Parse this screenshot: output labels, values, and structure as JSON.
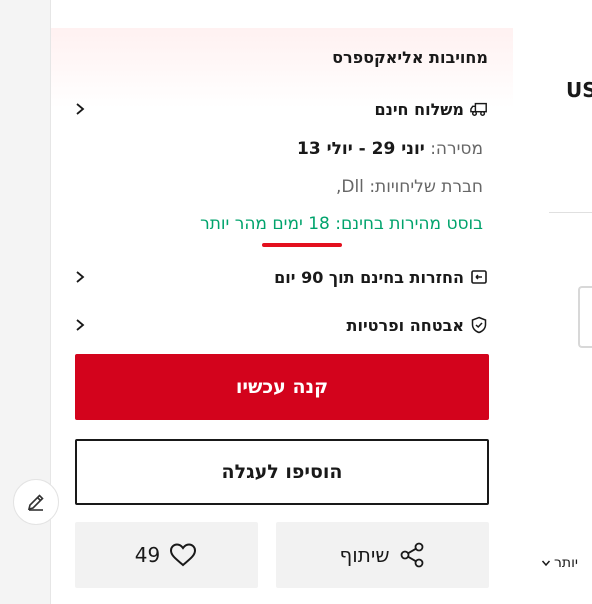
{
  "commitments": {
    "title": "מחויבות אליאקספרס",
    "free_shipping": {
      "label": "משלוח חינם",
      "delivery_label": "מסירה:",
      "delivery_value": "יוני 29 - יולי 13",
      "carrier_label": "חברת שליחויות:",
      "carrier_value": "Dll,",
      "boost_text": "בוסט מהירות בחינם: 18 ימים מהר יותר"
    },
    "returns_label": "החזרות בחינם תוך 90 יום",
    "security_label": "אבטחה ופרטיות"
  },
  "actions": {
    "buy_now": "קנה עכשיו",
    "add_to_cart": "הוסיפו לעגלה",
    "share": "שיתוף",
    "wishlist_count": "49"
  },
  "right_panel": {
    "currency_partial": "US",
    "more_partial": "יותר"
  },
  "colors": {
    "accent_red": "#d3031c",
    "boost_green": "#00a36c",
    "underline_red": "#e3101e"
  },
  "icons": {
    "shipping": "truck-icon",
    "returns": "return-box-icon",
    "security": "shield-check-icon",
    "chevron": "chevron-right-icon",
    "share": "share-icon",
    "heart": "heart-icon",
    "edit": "pencil-icon"
  }
}
